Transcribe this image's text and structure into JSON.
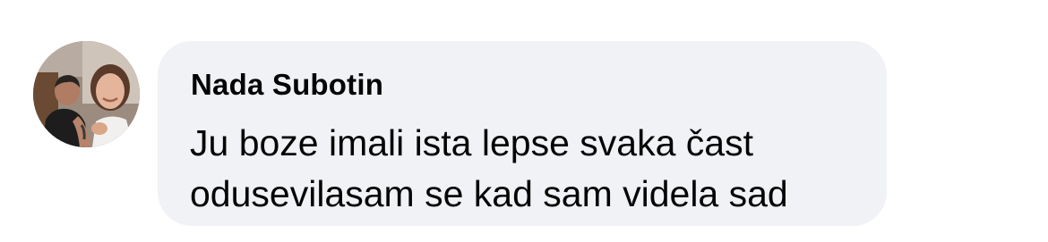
{
  "comment": {
    "author_name": "Nada Subotin",
    "text_lines": [
      "Ju boze imali ista lepse svaka čast",
      "odusevilasam se kad sam videla sad"
    ],
    "avatar_icon": "profile-photo",
    "bubble_color": "#f0f2f5",
    "text_color": "#050505"
  }
}
